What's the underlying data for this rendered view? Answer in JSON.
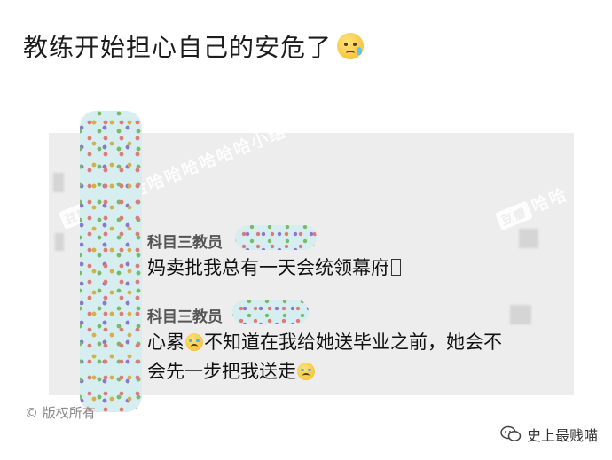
{
  "post": {
    "title": "教练开始担心自己的安危了"
  },
  "watermarks": {
    "logo": "豆瓣",
    "line1": "哈哈哈哈哈哈哈哈哈小组",
    "line2": "哈哈",
    "logo2": "豆瓣"
  },
  "messages": [
    {
      "sender": "科目三教员",
      "text": "妈卖批我总有一天会统领幕府"
    },
    {
      "sender": "科目三教员",
      "text_part1": "心累",
      "text_part2": "不知道在我给她送毕业之前，她会不",
      "text_line2": "会先一步把我送走"
    }
  ],
  "footer": {
    "copyright": "© 版权所有",
    "brand_name": "史上最贱喵"
  },
  "colors": {
    "background": "#ffffff",
    "screenshot_bg": "#ededed",
    "censor_base": "#d6eeef"
  }
}
